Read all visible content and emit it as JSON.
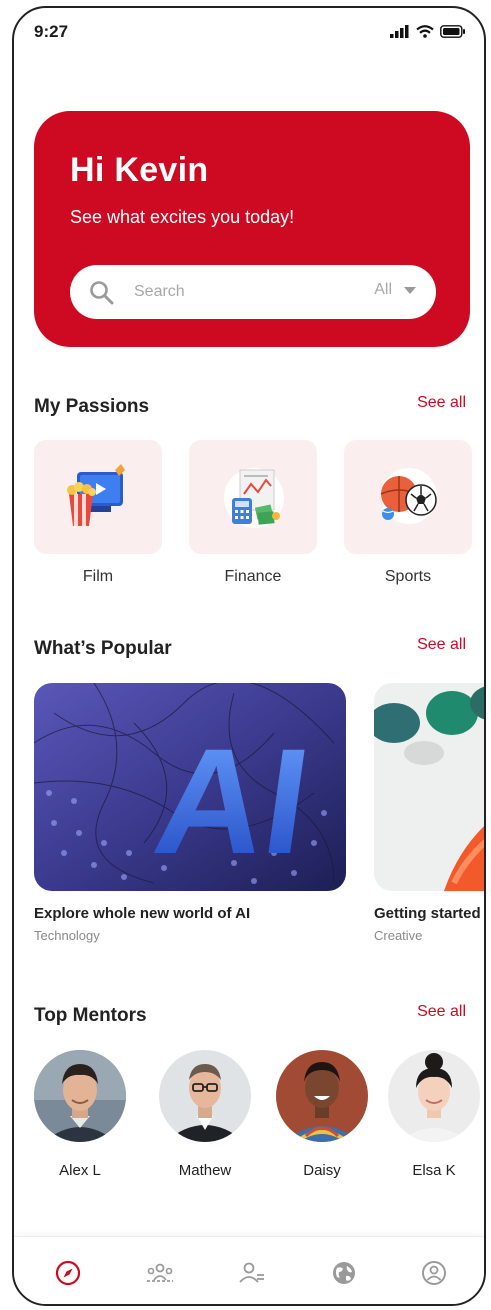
{
  "status": {
    "time": "9:27"
  },
  "hero": {
    "greeting": "Hi Kevin",
    "subtitle": "See what excites you today!",
    "search": {
      "placeholder": "Search",
      "filter": "All"
    }
  },
  "passions": {
    "title": "My Passions",
    "see_all": "See all",
    "items": [
      {
        "label": "Film",
        "icon": "film-icon"
      },
      {
        "label": "Finance",
        "icon": "finance-icon"
      },
      {
        "label": "Sports",
        "icon": "sports-icon"
      }
    ]
  },
  "popular": {
    "title": "What’s Popular",
    "see_all": "See all",
    "items": [
      {
        "title": "Explore whole new world of AI",
        "category": "Technology",
        "image_text": "AI"
      },
      {
        "title": "Getting started",
        "category": "Creative"
      }
    ]
  },
  "mentors": {
    "title": "Top Mentors",
    "see_all": "See all",
    "items": [
      {
        "name": "Alex L"
      },
      {
        "name": "Mathew"
      },
      {
        "name": "Daisy"
      },
      {
        "name": "Elsa K"
      }
    ]
  },
  "tabbar": {
    "items": [
      "compass-icon",
      "community-icon",
      "mentors-icon",
      "globe-icon",
      "profile-icon"
    ],
    "active_color": "#cd0a21",
    "inactive_color": "#9a9a9a"
  },
  "colors": {
    "accent": "#cd0a21",
    "card_bg": "#fbeeee"
  }
}
